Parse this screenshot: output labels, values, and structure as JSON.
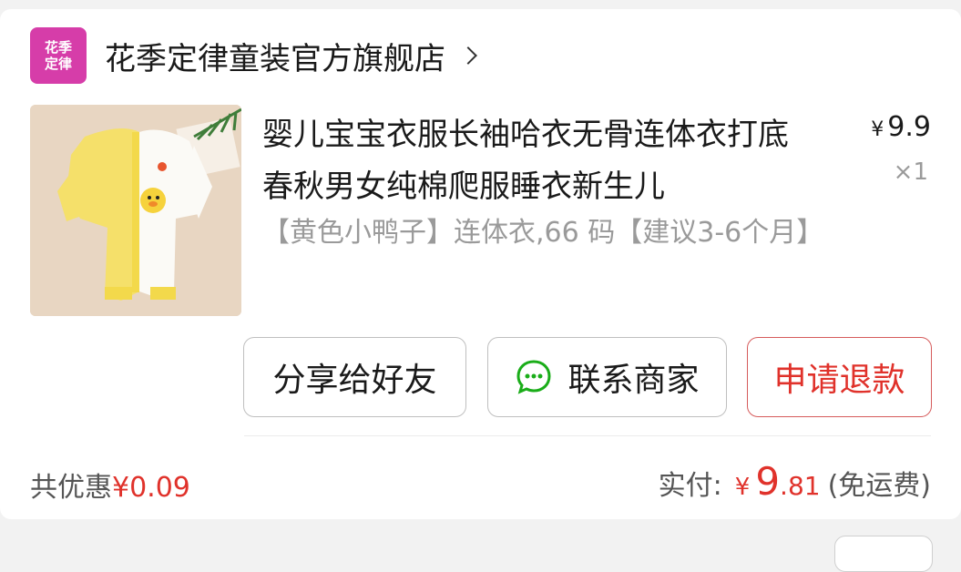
{
  "shop": {
    "logo_text": "花季\n定律",
    "name": "花季定律童装官方旗舰店"
  },
  "product": {
    "title": "婴儿宝宝衣服长袖哈衣无骨连体衣打底春秋男女纯棉爬服睡衣新生儿",
    "spec": "【黄色小鸭子】连体衣,66 码【建议3-6个月】",
    "price_currency": "¥",
    "price": "9.9",
    "quantity": "×1"
  },
  "actions": {
    "share_label": "分享给好友",
    "contact_label": "联系商家",
    "refund_label": "申请退款"
  },
  "summary": {
    "discount_label": "共优惠",
    "discount_amount": "¥0.09",
    "paid_label": "实付:",
    "paid_currency": "¥",
    "paid_integer": "9",
    "paid_decimal": ".81",
    "shipping_note": "(免运费)"
  },
  "colors": {
    "accent_red": "#e0322b",
    "logo_bg": "#d63da9",
    "wechat_green": "#1aad19"
  }
}
